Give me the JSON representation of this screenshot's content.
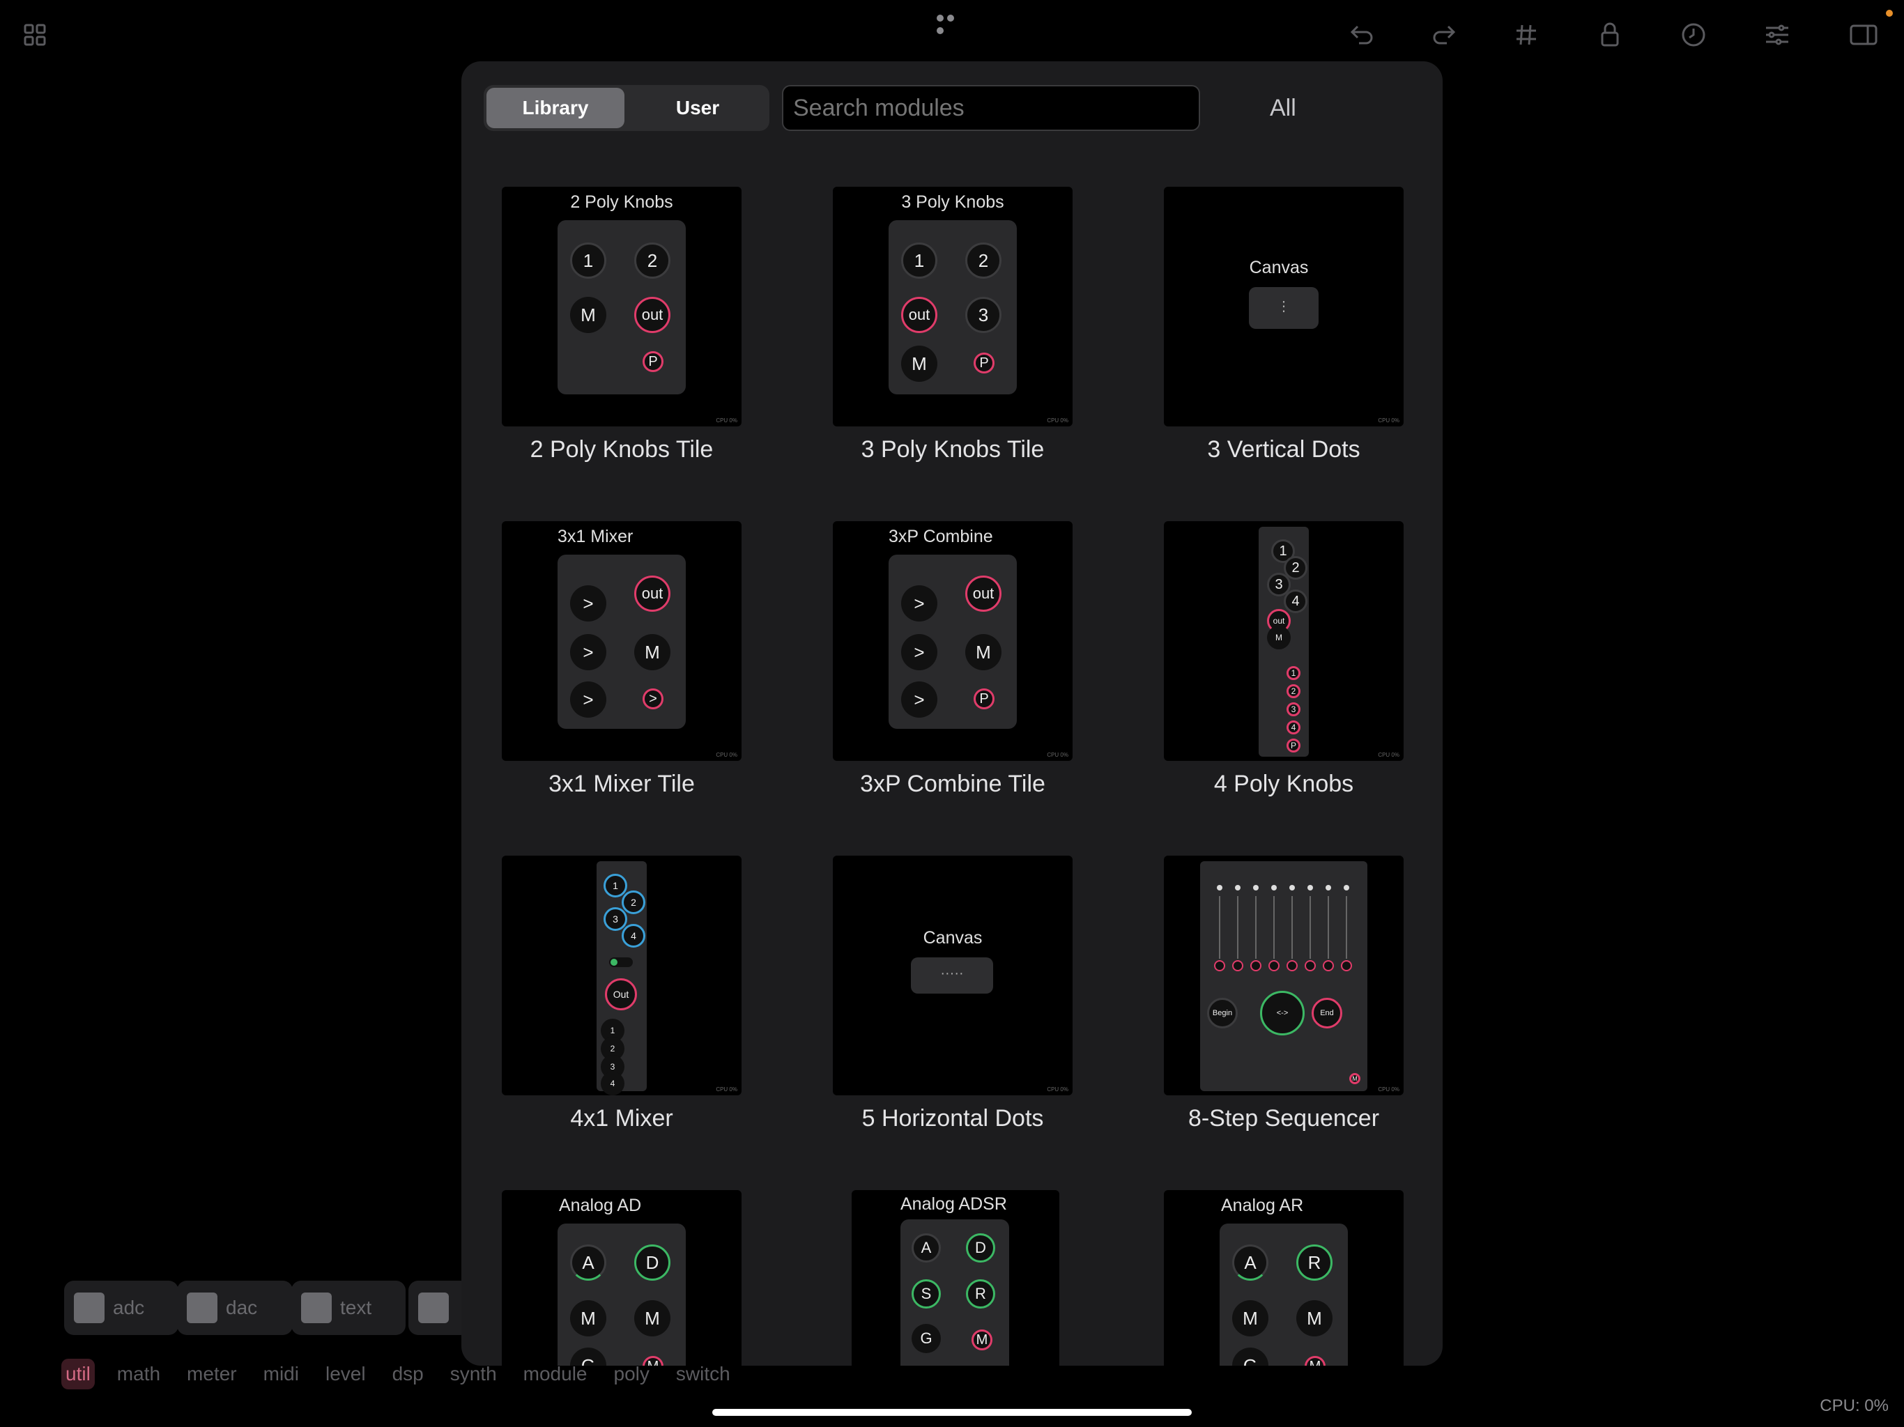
{
  "toolbar": {
    "icons": [
      "grid-icon",
      "undo-icon",
      "redo-icon",
      "hash-icon",
      "lock-icon",
      "clock-icon",
      "sliders-icon",
      "sidebar-icon"
    ]
  },
  "segment": {
    "library": "Library",
    "user": "User"
  },
  "search": {
    "placeholder": "Search modules"
  },
  "filter": {
    "all": "All"
  },
  "tiles": [
    {
      "title": "2 Poly Knobs",
      "label": "2 Poly Knobs Tile"
    },
    {
      "title": "3 Poly Knobs",
      "label": "3 Poly Knobs Tile"
    },
    {
      "title": "Canvas",
      "label": "3 Vertical Dots"
    },
    {
      "title": "3x1 Mixer",
      "label": "3x1 Mixer Tile"
    },
    {
      "title": "3xP Combine",
      "label": "3xP Combine Tile"
    },
    {
      "title": "4 Poly Knobs",
      "label": "4 Poly Knobs"
    },
    {
      "title": "4x1 Mixer",
      "label": "4x1 Mixer"
    },
    {
      "title": "Canvas",
      "label": "5 Horizontal Dots"
    },
    {
      "title": "8-Step Sequencer",
      "label": "8-Step Sequencer"
    },
    {
      "title": "Analog AD",
      "label": ""
    },
    {
      "title": "Analog ADSR",
      "label": ""
    },
    {
      "title": "Analog AR",
      "label": ""
    }
  ],
  "dock": [
    {
      "label": "adc",
      "icon": "adc-icon"
    },
    {
      "label": "dac",
      "icon": "speaker-icon"
    },
    {
      "label": "text",
      "icon": "text-icon"
    }
  ],
  "categories": [
    "util",
    "math",
    "meter",
    "midi",
    "level",
    "dsp",
    "synth",
    "module",
    "poly",
    "switch"
  ],
  "cpu": "CPU: 0%",
  "colors": {
    "accent_red": "#e03c6a",
    "accent_green": "#3cb864",
    "panel": "#1c1c1e"
  }
}
